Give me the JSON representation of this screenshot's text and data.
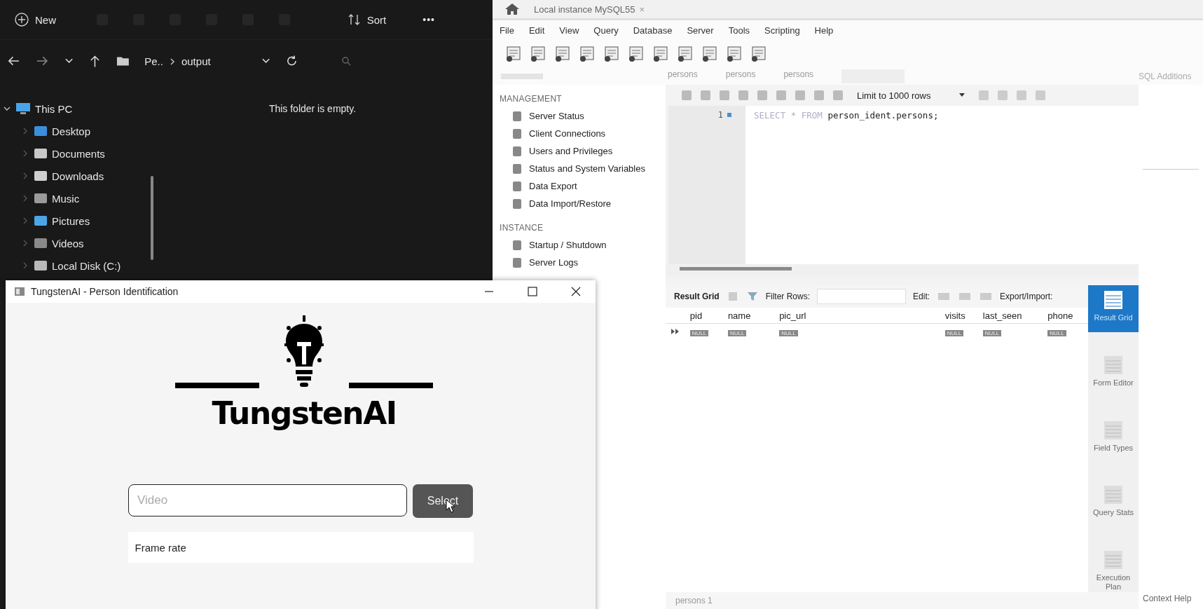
{
  "explorer": {
    "toolbar": {
      "new": "New",
      "sort": "Sort",
      "more": "•••"
    },
    "breadcrumb": [
      "Pe..",
      "output"
    ],
    "empty_message": "This folder is empty.",
    "tree": [
      {
        "label": "This PC",
        "kind": "pc",
        "expanded": true,
        "children": [
          {
            "label": "Desktop",
            "kind": "desktop",
            "expanded": false
          },
          {
            "label": "Documents",
            "kind": "documents",
            "expanded": false
          },
          {
            "label": "Downloads",
            "kind": "downloads",
            "expanded": false
          },
          {
            "label": "Music",
            "kind": "music",
            "expanded": false
          },
          {
            "label": "Pictures",
            "kind": "pictures",
            "expanded": false
          },
          {
            "label": "Videos",
            "kind": "videos",
            "expanded": false
          },
          {
            "label": "Local Disk (C:)",
            "kind": "disk",
            "expanded": false
          }
        ]
      }
    ]
  },
  "workbench": {
    "tab": "Local instance MySQL55",
    "tab_close": "×",
    "menu": [
      "File",
      "Edit",
      "View",
      "Query",
      "Database",
      "Server",
      "Tools",
      "Scripting",
      "Help"
    ],
    "editor_tabs": [
      "persons",
      "persons",
      "persons"
    ],
    "right_panel_title": "SQL Additions",
    "navigator": [
      {
        "title": "MANAGEMENT",
        "items": [
          "Server Status",
          "Client Connections",
          "Users and Privileges",
          "Status and System Variables",
          "Data Export",
          "Data Import/Restore"
        ]
      },
      {
        "title": "INSTANCE",
        "items": [
          "Startup / Shutdown",
          "Server Logs"
        ]
      }
    ],
    "limit": "Limit to 1000 rows",
    "sql": {
      "line": "1",
      "tokens": [
        {
          "text": "SELECT",
          "kind": "keyword"
        },
        {
          "text": "*",
          "kind": "keyword"
        },
        {
          "text": "FROM",
          "kind": "keyword"
        },
        {
          "text": "person_ident.persons;",
          "kind": "name"
        }
      ]
    },
    "results": {
      "toolbar": {
        "result_grid": "Result Grid",
        "filter": "Filter Rows:",
        "edit": "Edit:",
        "export": "Export/Import:"
      },
      "columns": [
        "pid",
        "name",
        "pic_url",
        "visits",
        "last_seen",
        "phone"
      ],
      "row": [
        "NULL",
        "NULL",
        "NULL",
        "NULL",
        "NULL",
        "NULL"
      ]
    },
    "side_tabs": [
      {
        "label": "Result Grid",
        "selected": true
      },
      {
        "label": "Form Editor",
        "selected": false
      },
      {
        "label": "Field Types",
        "selected": false
      },
      {
        "label": "Query Stats",
        "selected": false
      },
      {
        "label": "Execution Plan",
        "selected": false
      }
    ],
    "bottom_tab": "persons 1",
    "context_help": "Context Help"
  },
  "app": {
    "title": "TungstenAI - Person Identification",
    "logo": "TungstenAI",
    "video": {
      "placeholder": "Video"
    },
    "select": "Select",
    "frame_rate": "Frame rate"
  }
}
